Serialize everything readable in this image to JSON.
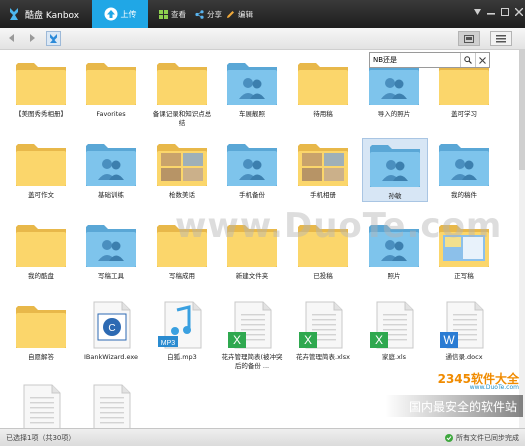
{
  "app": {
    "title": "酷盘 Kanbox"
  },
  "toolbar": {
    "upload": "上传",
    "view": "查看",
    "share": "分享",
    "edit": "编辑"
  },
  "search": {
    "value": "NB还是"
  },
  "items": [
    {
      "label": "【美图秀秀相册】",
      "type": "folder"
    },
    {
      "label": "Favorites",
      "type": "folder"
    },
    {
      "label": "备课记录和知识点总结",
      "type": "folder"
    },
    {
      "label": "车展靓照",
      "type": "shared"
    },
    {
      "label": "待用稿",
      "type": "folder"
    },
    {
      "label": "导入的照片",
      "type": "shared"
    },
    {
      "label": "盖可学习",
      "type": "folder"
    },
    {
      "label": "盖可作文",
      "type": "folder"
    },
    {
      "label": "基础训练",
      "type": "shared"
    },
    {
      "label": "枪数美话",
      "type": "photo"
    },
    {
      "label": "手机备份",
      "type": "shared"
    },
    {
      "label": "手机相册",
      "type": "photo"
    },
    {
      "label": "孙敏",
      "type": "shared"
    },
    {
      "label": "我的稿件",
      "type": "shared"
    },
    {
      "label": "我的酷盘",
      "type": "folder"
    },
    {
      "label": "写稿工具",
      "type": "shared"
    },
    {
      "label": "写稿成用",
      "type": "folder"
    },
    {
      "label": "新建文件夹",
      "type": "folder"
    },
    {
      "label": "已投稿",
      "type": "folder"
    },
    {
      "label": "照片",
      "type": "shared"
    },
    {
      "label": "正写稿",
      "type": "screen"
    },
    {
      "label": "自愿解答",
      "type": "folder"
    },
    {
      "label": "IBankWizard.exe",
      "type": "exe"
    },
    {
      "label": "白狐.mp3",
      "type": "mp3"
    },
    {
      "label": "花卉管理简表(被冲突后的备份 ...",
      "type": "xls"
    },
    {
      "label": "花卉管理简表.xlsx",
      "type": "xls"
    },
    {
      "label": "家庭.xls",
      "type": "xls"
    },
    {
      "label": "通信录.docx",
      "type": "doc"
    },
    {
      "label": "",
      "type": "blank"
    },
    {
      "label": "",
      "type": "blank"
    }
  ],
  "status": {
    "left": "已选择1项（共30项）",
    "right": "所有文件已同步完成"
  },
  "watermark": "www.DuoTe.com",
  "corner": {
    "logo": "2345软件大全",
    "sub": "www.DuoTe.com",
    "banner": "国内最安全的软件站"
  }
}
